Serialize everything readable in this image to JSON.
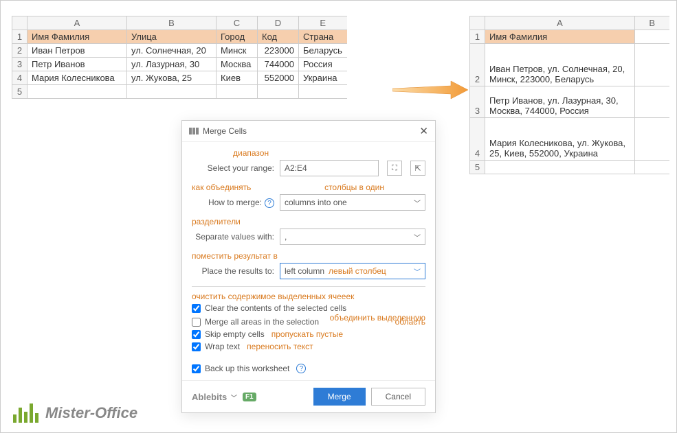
{
  "left_grid": {
    "cols": [
      "A",
      "B",
      "C",
      "D",
      "E"
    ],
    "header": [
      "Имя Фамилия",
      "Улица",
      "Город",
      "Код",
      "Страна"
    ],
    "rows": [
      [
        "Иван Петров",
        "ул. Солнечная, 20",
        "Минск",
        "223000",
        "Беларусь"
      ],
      [
        "Петр Иванов",
        "ул. Лазурная, 30",
        "Москва",
        "744000",
        "Россия"
      ],
      [
        "Мария Колесникова",
        "ул. Жукова, 25",
        "Киев",
        "552000",
        "Украина"
      ]
    ],
    "row_labels": [
      "1",
      "2",
      "3",
      "4",
      "5"
    ]
  },
  "right_grid": {
    "cols": [
      "A",
      "B"
    ],
    "row_labels": [
      "1",
      "2",
      "3",
      "4",
      "5"
    ],
    "header": "Имя Фамилия",
    "cells": [
      "Иван Петров, ул. Солнечная, 20, Минск, 223000, Беларусь",
      "Петр Иванов, ул. Лазурная, 30, Москва, 744000, Россия",
      "Мария Колесникова, ул. Жукова, 25, Киев, 552000, Украина"
    ]
  },
  "dialog": {
    "title": "Merge Cells",
    "range_label": "Select your range:",
    "range_value": "A2:E4",
    "how_label": "How to merge:",
    "how_value": "columns into one",
    "sep_label": "Separate values with:",
    "sep_value": ",",
    "place_label": "Place the results to:",
    "place_value": "left column",
    "place_ann_right": "левый столбец",
    "check1": "Clear the contents of the selected cells",
    "check2": "Merge all areas in the selection",
    "check3": "Skip empty cells",
    "check4": "Wrap text",
    "check5": "Back up this worksheet",
    "brand": "Ablebits",
    "f1": "F1",
    "merge_btn": "Merge",
    "cancel_btn": "Cancel"
  },
  "annotations": {
    "diapazon": "диапазон",
    "how": "как объединять",
    "cols_one": "столбцы в один",
    "separators": "разделители",
    "place": "поместить результат в",
    "clear": "очистить содержимое выделенных ячееек",
    "merge_area1": "объединить выделенную",
    "merge_area2": "область",
    "skip": "пропускать пустые",
    "wrap": "переносить текст"
  },
  "logo": "Mister-Office"
}
